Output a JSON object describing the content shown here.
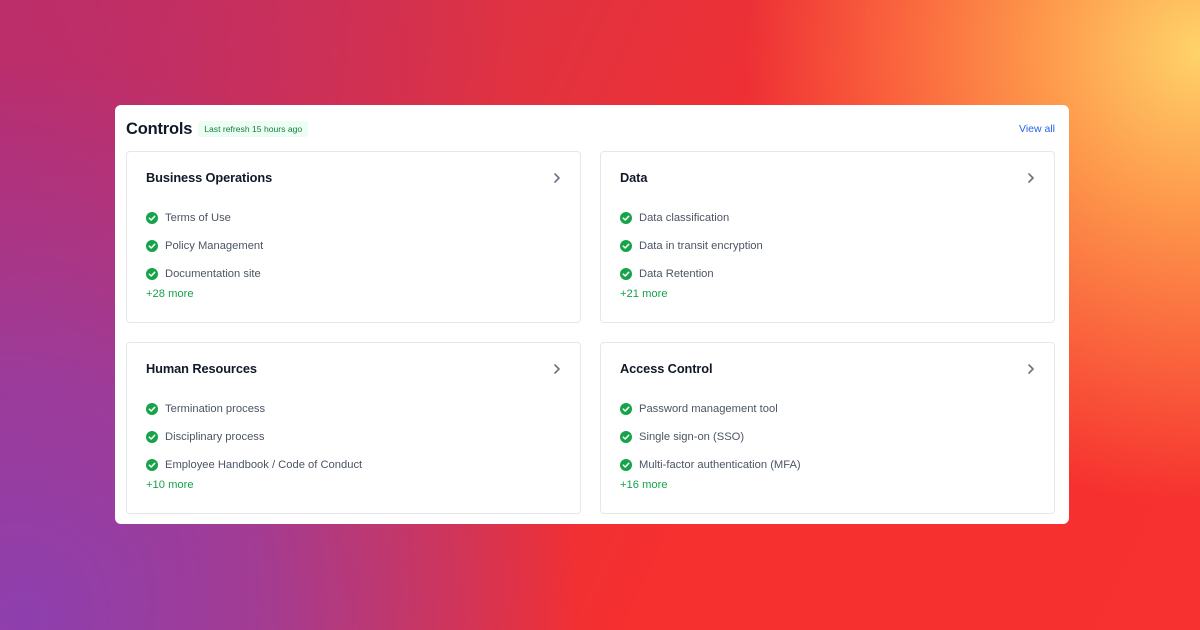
{
  "header": {
    "title": "Controls",
    "refresh_badge": "Last refresh 15 hours ago",
    "view_all": "View all"
  },
  "colors": {
    "accent": "#2563eb",
    "success": "#16a34a",
    "badge_bg": "#ecfdf3"
  },
  "icons": {
    "item_status": "check-circle-icon",
    "card_nav": "chevron-right-icon"
  },
  "cards": [
    {
      "title": "Business Operations",
      "items": [
        "Terms of Use",
        "Policy Management",
        "Documentation site"
      ],
      "more": "+28 more"
    },
    {
      "title": "Data",
      "items": [
        "Data classification",
        "Data in transit encryption",
        "Data Retention"
      ],
      "more": "+21 more"
    },
    {
      "title": "Human Resources",
      "items": [
        "Termination process",
        "Disciplinary process",
        "Employee Handbook / Code of Conduct"
      ],
      "more": "+10 more"
    },
    {
      "title": "Access Control",
      "items": [
        "Password management tool",
        "Single sign-on (SSO)",
        "Multi-factor authentication (MFA)"
      ],
      "more": "+16 more"
    }
  ]
}
